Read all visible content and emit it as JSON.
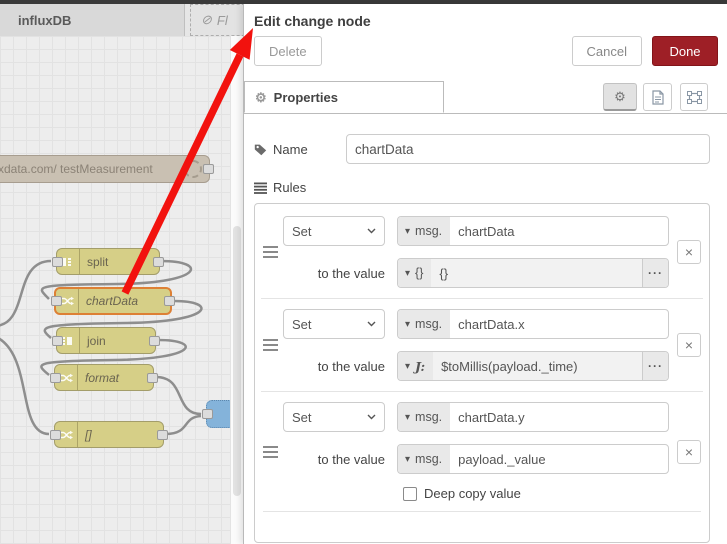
{
  "canvas": {
    "tabs": {
      "active": "influxDB",
      "disabled_partial": "Fl"
    },
    "nodes": {
      "influx": {
        "label": "xdata.com/ testMeasurement"
      },
      "split": {
        "label": "split"
      },
      "chartdata": {
        "label": "chartData",
        "selected": true
      },
      "join": {
        "label": "join"
      },
      "format": {
        "label": "format"
      },
      "bracket": {
        "label": "[]"
      }
    }
  },
  "panel": {
    "title": "Edit change node",
    "delete_label": "Delete",
    "cancel_label": "Cancel",
    "done_label": "Done",
    "properties_tab": "Properties",
    "form": {
      "name_label": "Name",
      "name_value": "chartData",
      "rules_label": "Rules",
      "to_value_label": "to the value",
      "deep_copy_label": "Deep copy value",
      "rules": [
        {
          "action": "Set",
          "prop_type": "msg.",
          "prop": "chartData",
          "val_type": "{}",
          "value": "{}"
        },
        {
          "action": "Set",
          "prop_type": "msg.",
          "prop": "chartData.x",
          "val_type": "J:",
          "value": "$toMillis(payload._time)"
        },
        {
          "action": "Set",
          "prop_type": "msg.",
          "prop": "chartData.y",
          "val_type": "msg.",
          "value": "payload._value"
        }
      ]
    }
  },
  "icons": {
    "caret_down": "▾",
    "prohibit": "⊘",
    "gear": "⚙",
    "close": "×",
    "expand": "···"
  },
  "colors": {
    "done_button": "#9e1f26",
    "node_fill": "#d6cf87",
    "node_selected_border": "#dd8035",
    "influx_node_fill": "#c9c0b2",
    "chart_node_fill": "#84b3da",
    "annotation_arrow": "#f2120e"
  }
}
